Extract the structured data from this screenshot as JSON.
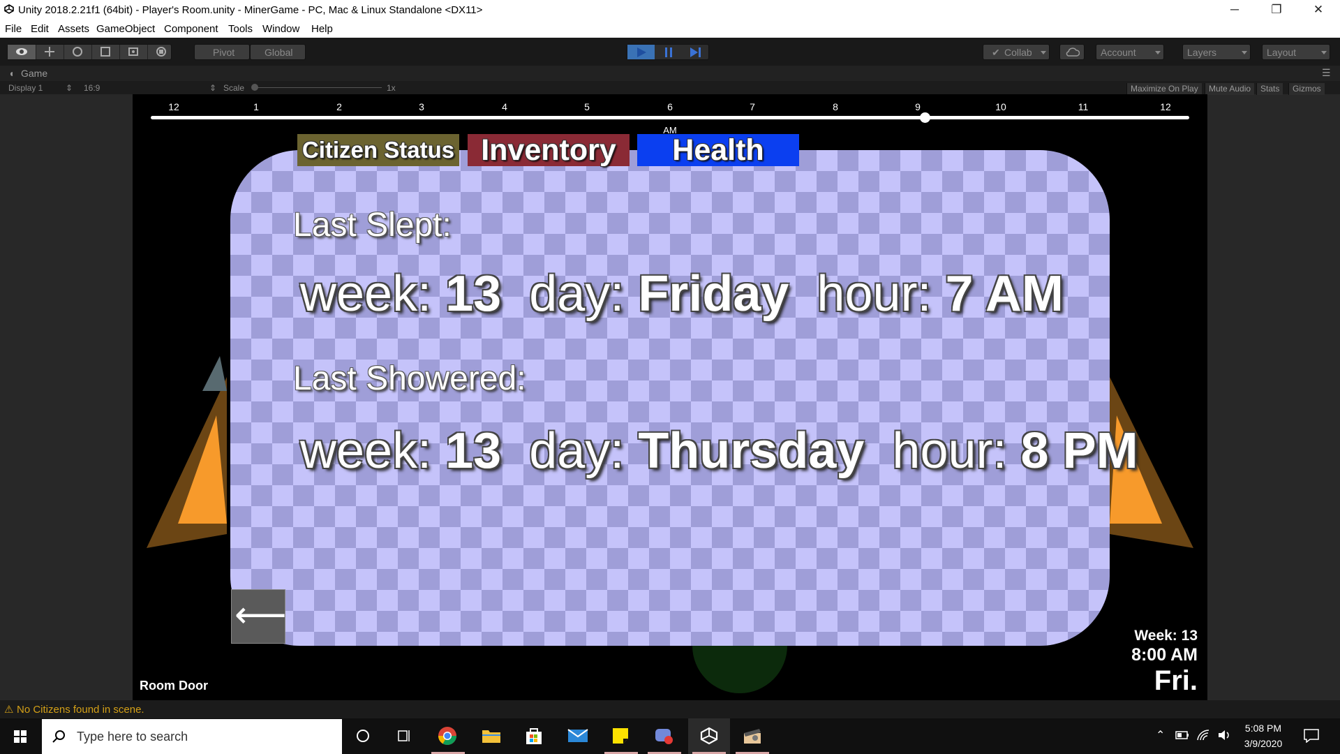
{
  "window": {
    "title": "Unity 2018.2.21f1 (64bit) - Player's Room.unity - MinerGame - PC, Mac & Linux Standalone <DX11>",
    "minimize_glyph": "─",
    "restore_glyph": "❐",
    "close_glyph": "✕"
  },
  "menu": [
    "File",
    "Edit",
    "Assets",
    "GameObject",
    "Component",
    "Tools",
    "Window",
    "Help"
  ],
  "toolbar": {
    "pivot_label": "Pivot",
    "global_label": "Global",
    "collab_label": "Collab",
    "account_label": "Account",
    "layers_label": "Layers",
    "layout_label": "Layout",
    "play_color": "#3a72b5"
  },
  "game_panel": {
    "tab_label": "Game",
    "display_label": "Display 1",
    "aspect_label": "16:9",
    "scale_label": "Scale",
    "scale_value": "1x",
    "maximize_on_play": "Maximize On Play",
    "mute_audio": "Mute Audio",
    "stats": "Stats",
    "gizmos": "Gizmos"
  },
  "game": {
    "clock_hours": [
      "12",
      "1",
      "2",
      "3",
      "4",
      "5",
      "6",
      "7",
      "8",
      "9",
      "10",
      "11",
      "12"
    ],
    "clock_marker_label": "AM",
    "slider_fraction": 0.745,
    "tabs": {
      "citizen_status": "Citizen Status",
      "inventory": "Inventory",
      "health": "Health"
    },
    "tab_colors": {
      "citizen_status": "#6b6330",
      "inventory": "#8a2a35",
      "health": "#0b3ff0"
    },
    "last_slept_label": "Last Slept:",
    "last_slept": {
      "week_key": "week:",
      "week": "13",
      "day_key": "day:",
      "day": "Friday",
      "hour_key": "hour:",
      "hour": "7 AM"
    },
    "last_showered_label": "Last Showered:",
    "last_showered": {
      "week_key": "week:",
      "week": "13",
      "day_key": "day:",
      "day": "Thursday",
      "hour_key": "hour:",
      "hour": "8 PM"
    },
    "back_arrow": "⟵",
    "location_label": "Room Door",
    "hud_week": "Week: 13",
    "hud_time": "8:00 AM",
    "hud_day": "Fri."
  },
  "status_message": "No Citizens found in scene.",
  "taskbar": {
    "search_placeholder": "Type here to search",
    "clock_time": "5:08 PM",
    "clock_date": "3/9/2020"
  }
}
